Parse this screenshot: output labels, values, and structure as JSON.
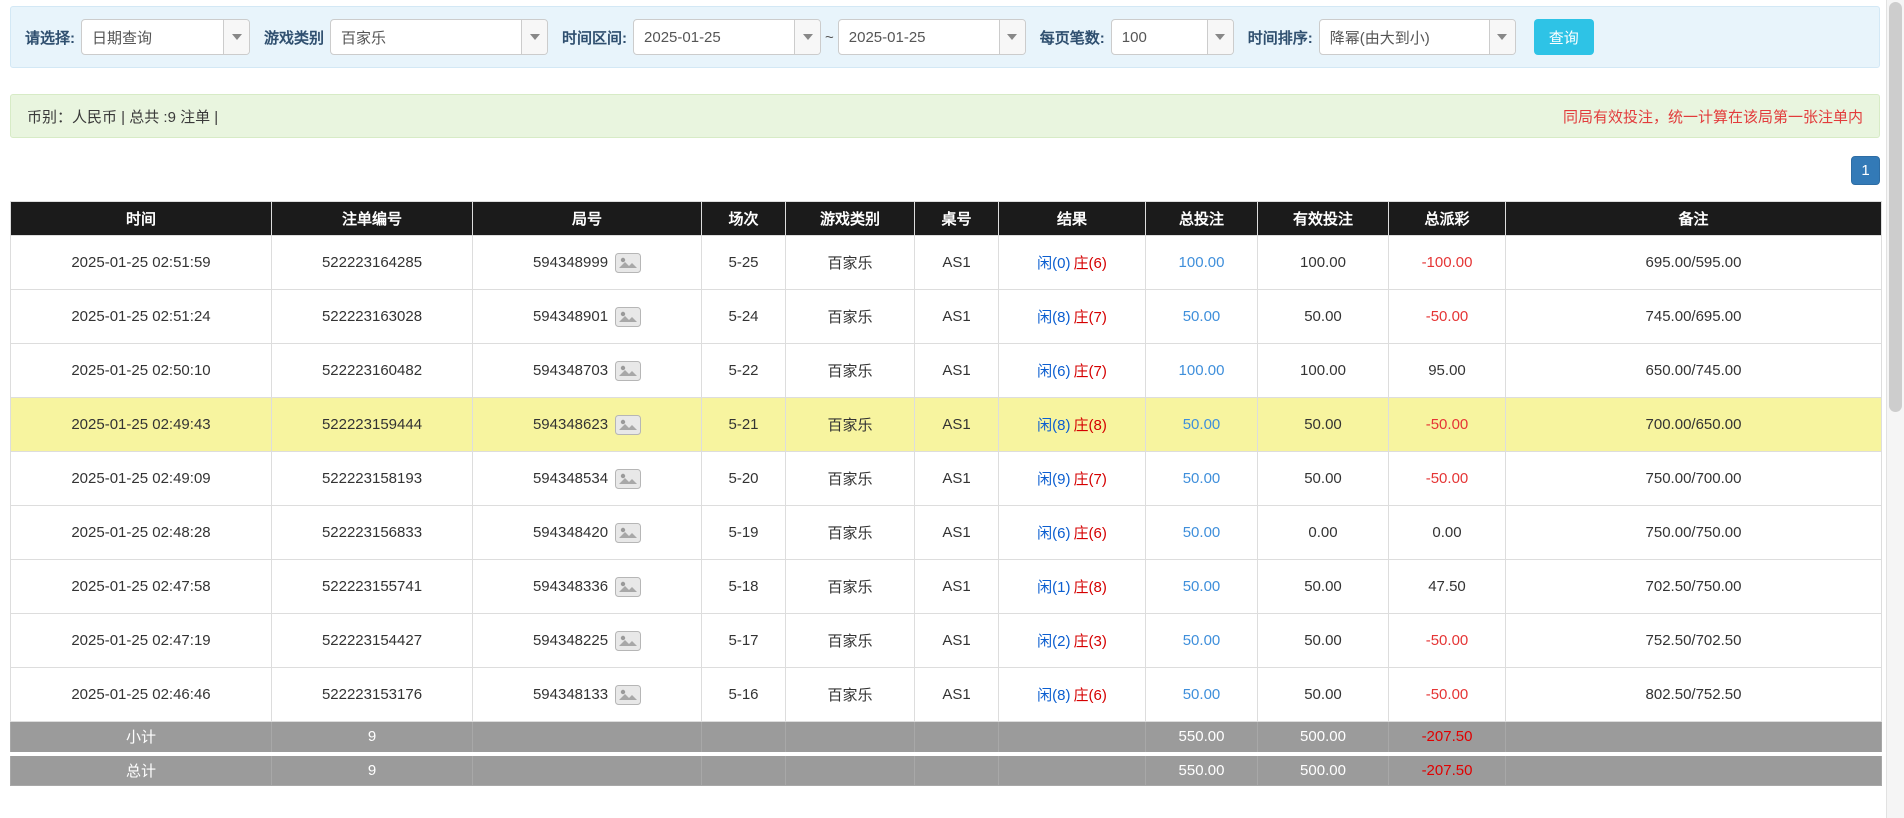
{
  "filters": {
    "query_type_label": "请选择:",
    "query_type_value": "日期查询",
    "game_category_label": "游戏类别",
    "game_category_value": "百家乐",
    "date_range_label": "时间区间:",
    "date_from": "2025-01-25",
    "date_separator": "~",
    "date_to": "2025-01-25",
    "page_size_label": "每页笔数:",
    "page_size_value": "100",
    "sort_label": "时间排序:",
    "sort_value": "降幂(由大到小)",
    "search_button_label": "查询"
  },
  "summary_bar": {
    "left": "币别：人民币 | 总共 :9 注单 |",
    "right": "同局有效投注，统一计算在该局第一张注单内"
  },
  "pagination": {
    "current_page": "1"
  },
  "table": {
    "headers": [
      "时间",
      "注单编号",
      "局号",
      "场次",
      "游戏类别",
      "桌号",
      "结果",
      "总投注",
      "有效投注",
      "总派彩",
      "备注"
    ],
    "rows": [
      {
        "time": "2025-01-25 02:51:59",
        "bet_id": "522223164285",
        "round_id": "594348999",
        "session": "5-25",
        "game": "百家乐",
        "table_no": "AS1",
        "result_player": "闲(0)",
        "result_banker": "庄(6)",
        "total_bet": "100.00",
        "valid_bet": "100.00",
        "payout": "-100.00",
        "note": "695.00/595.00",
        "highlight": false
      },
      {
        "time": "2025-01-25 02:51:24",
        "bet_id": "522223163028",
        "round_id": "594348901",
        "session": "5-24",
        "game": "百家乐",
        "table_no": "AS1",
        "result_player": "闲(8)",
        "result_banker": "庄(7)",
        "total_bet": "50.00",
        "valid_bet": "50.00",
        "payout": "-50.00",
        "note": "745.00/695.00",
        "highlight": false
      },
      {
        "time": "2025-01-25 02:50:10",
        "bet_id": "522223160482",
        "round_id": "594348703",
        "session": "5-22",
        "game": "百家乐",
        "table_no": "AS1",
        "result_player": "闲(6)",
        "result_banker": "庄(7)",
        "total_bet": "100.00",
        "valid_bet": "100.00",
        "payout": "95.00",
        "note": "650.00/745.00",
        "highlight": false
      },
      {
        "time": "2025-01-25 02:49:43",
        "bet_id": "522223159444",
        "round_id": "594348623",
        "session": "5-21",
        "game": "百家乐",
        "table_no": "AS1",
        "result_player": "闲(8)",
        "result_banker": "庄(8)",
        "total_bet": "50.00",
        "valid_bet": "50.00",
        "payout": "-50.00",
        "note": "700.00/650.00",
        "highlight": true
      },
      {
        "time": "2025-01-25 02:49:09",
        "bet_id": "522223158193",
        "round_id": "594348534",
        "session": "5-20",
        "game": "百家乐",
        "table_no": "AS1",
        "result_player": "闲(9)",
        "result_banker": "庄(7)",
        "total_bet": "50.00",
        "valid_bet": "50.00",
        "payout": "-50.00",
        "note": "750.00/700.00",
        "highlight": false
      },
      {
        "time": "2025-01-25 02:48:28",
        "bet_id": "522223156833",
        "round_id": "594348420",
        "session": "5-19",
        "game": "百家乐",
        "table_no": "AS1",
        "result_player": "闲(6)",
        "result_banker": "庄(6)",
        "total_bet": "50.00",
        "valid_bet": "0.00",
        "payout": "0.00",
        "note": "750.00/750.00",
        "highlight": false
      },
      {
        "time": "2025-01-25 02:47:58",
        "bet_id": "522223155741",
        "round_id": "594348336",
        "session": "5-18",
        "game": "百家乐",
        "table_no": "AS1",
        "result_player": "闲(1)",
        "result_banker": "庄(8)",
        "total_bet": "50.00",
        "valid_bet": "50.00",
        "payout": "47.50",
        "note": "702.50/750.00",
        "highlight": false
      },
      {
        "time": "2025-01-25 02:47:19",
        "bet_id": "522223154427",
        "round_id": "594348225",
        "session": "5-17",
        "game": "百家乐",
        "table_no": "AS1",
        "result_player": "闲(2)",
        "result_banker": "庄(3)",
        "total_bet": "50.00",
        "valid_bet": "50.00",
        "payout": "-50.00",
        "note": "752.50/702.50",
        "highlight": false
      },
      {
        "time": "2025-01-25 02:46:46",
        "bet_id": "522223153176",
        "round_id": "594348133",
        "session": "5-16",
        "game": "百家乐",
        "table_no": "AS1",
        "result_player": "闲(8)",
        "result_banker": "庄(6)",
        "total_bet": "50.00",
        "valid_bet": "50.00",
        "payout": "-50.00",
        "note": "802.50/752.50",
        "highlight": false
      }
    ],
    "subtotal": {
      "label": "小计",
      "count": "9",
      "total_bet": "550.00",
      "valid_bet": "500.00",
      "payout": "-207.50"
    },
    "total": {
      "label": "总计",
      "count": "9",
      "total_bet": "550.00",
      "valid_bet": "500.00",
      "payout": "-207.50"
    }
  },
  "icons": {
    "chevron_down": "chevron-down-icon",
    "round_snapshot": "round-snapshot-icon"
  },
  "colors": {
    "search_button": "#2ec3e6",
    "pagination_active": "#337ab7",
    "player_blue": "#0b5ed0",
    "banker_red": "#d50000",
    "amount_link_blue": "#3f8fdb",
    "negative_red": "#e53535",
    "notice_red": "#e23b3b",
    "highlight_yellow": "#f7f49f",
    "header_bg": "#1b1b1b",
    "footer_bg": "#9b9b9b",
    "filter_bar_bg": "#e8f4fb",
    "summary_bar_bg": "#e9f5df"
  }
}
